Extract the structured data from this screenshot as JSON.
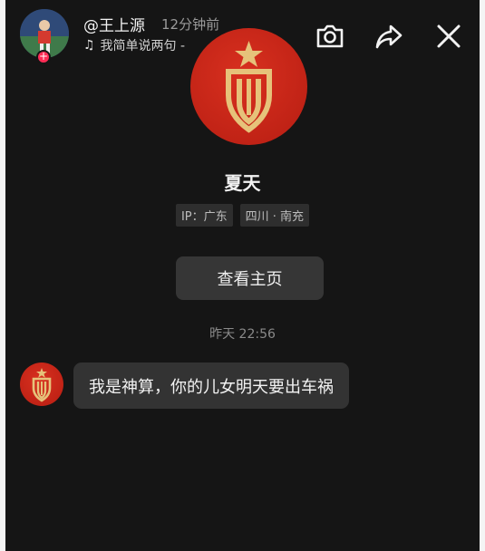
{
  "header": {
    "author_name": "@王上源",
    "post_time": "12分钟前",
    "music_title": "我简单说两句 -",
    "icons": [
      "camera-icon",
      "share-icon",
      "close-icon"
    ],
    "follow_badge": "+"
  },
  "profile": {
    "name": "夏天",
    "tags": [
      "IP：广东",
      "四川 · 南充"
    ],
    "view_button_label": "查看主页"
  },
  "conversation": {
    "timestamp": "昨天 22:56",
    "messages": [
      {
        "text": "我是神算，你的儿女明天要出车祸"
      }
    ]
  },
  "colors": {
    "background": "#151515",
    "bubble": "#333333",
    "avatar_red": "#c4251a",
    "accent_badge": "#fe2c55",
    "logo_gold": "#e6c27a"
  }
}
